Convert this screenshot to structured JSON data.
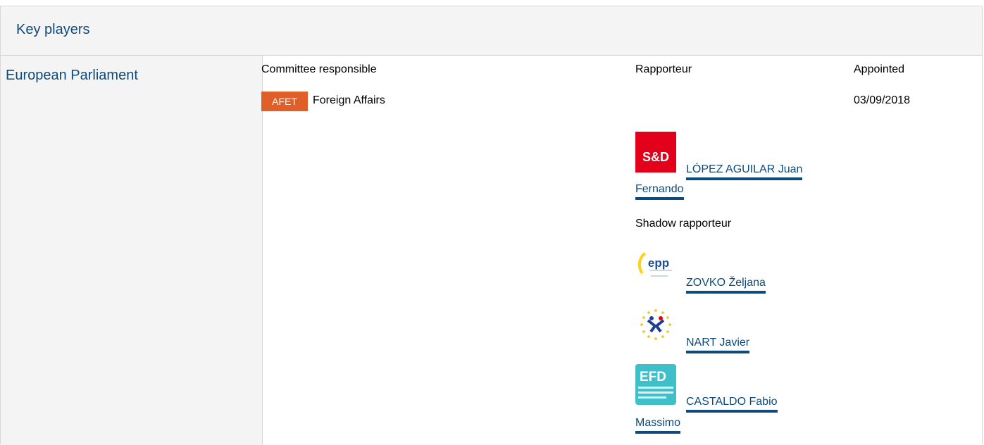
{
  "header": {
    "title": "Key players"
  },
  "institution": {
    "name": "European Parliament"
  },
  "columns": {
    "committee": "Committee responsible",
    "rapporteur": "Rapporteur",
    "appointed": "Appointed"
  },
  "committee": {
    "badge": "AFET",
    "badge_color": "#e05f29",
    "name": "Foreign Affairs",
    "appointed": "03/09/2018"
  },
  "rapporteur": {
    "group_logo": "S&D",
    "group_logo_icon": "sd-group-logo-icon",
    "name_line1": "LÓPEZ AGUILAR Juan",
    "name_line2": "Fernando"
  },
  "shadow": {
    "label": "Shadow rapporteur",
    "members": [
      {
        "logo_icon": "epp-group-logo-icon",
        "logo_text": "epp",
        "name_line1": "ZOVKO Željana",
        "name_line2": ""
      },
      {
        "logo_icon": "renew-group-logo-icon",
        "logo_text": "",
        "name_line1": "NART Javier",
        "name_line2": ""
      },
      {
        "logo_icon": "efdd-group-logo-icon",
        "logo_text": "EFD",
        "name_line1": "CASTALDO Fabio",
        "name_line2": "Massimo"
      }
    ]
  },
  "colors": {
    "link": "#0e4a7b",
    "header_bg": "#f4f4f4",
    "sd_red": "#e3001b",
    "efdd_teal": "#3fbfc7"
  }
}
